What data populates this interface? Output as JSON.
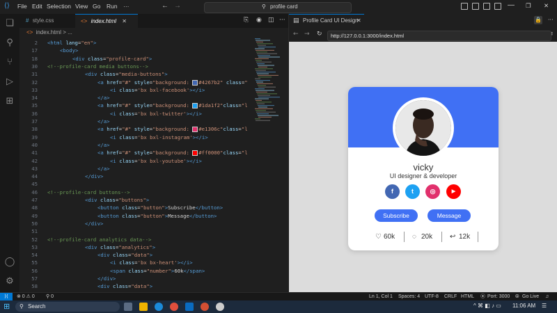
{
  "titlebar": {
    "menus": [
      "File",
      "Edit",
      "Selection",
      "View",
      "Go",
      "Run",
      "···"
    ],
    "search_text": "profile card"
  },
  "editor": {
    "tabs": [
      {
        "label": "style.css",
        "icon": "#",
        "active": false
      },
      {
        "label": "index.html",
        "icon": "<>",
        "active": true
      }
    ],
    "close_glyph": "✕",
    "breadcrumb": "index.html > ...",
    "lines": [
      {
        "n": "2",
        "indent": 0,
        "html": "<span class='tg'>&lt;html</span> <span class='at'>lang</span>=<span class='st'>\"en\"</span><span class='tg'>&gt;</span>"
      },
      {
        "n": "17",
        "indent": 1,
        "html": "<span class='tg'>&lt;body&gt;</span>"
      },
      {
        "n": "18",
        "indent": 2,
        "html": "<span class='tg'>&lt;div</span> <span class='at'>class</span>=<span class='st'>\"profile-card\"</span><span class='tg'>&gt;</span>"
      },
      {
        "n": "30",
        "indent": 0,
        "html": "<span class='cm'>&lt;!--profile-card media buttons--&gt;</span>"
      },
      {
        "n": "31",
        "indent": 3,
        "html": "<span class='tg'>&lt;div</span> <span class='at'>class</span>=<span class='st'>\"media-buttons\"</span><span class='tg'>&gt;</span>"
      },
      {
        "n": "32",
        "indent": 4,
        "html": "<span class='tg'>&lt;a</span> <span class='at'>href</span>=<span class='st'>\"#\"</span> <span class='at'>style</span>=<span class='st'>\"background: <i class='sw' style='background:#4267b2'></i>#4267b2\"</span> <span class='at'>class</span>=<span class='st'>\"</span>"
      },
      {
        "n": "33",
        "indent": 5,
        "html": "<span class='tg'>&lt;i</span> <span class='at'>class</span>=<span class='st'>'bx bxl-facebook'</span><span class='tg'>&gt;&lt;/i&gt;</span>"
      },
      {
        "n": "34",
        "indent": 4,
        "html": "<span class='tg'>&lt;/a&gt;</span>"
      },
      {
        "n": "35",
        "indent": 4,
        "html": "<span class='tg'>&lt;a</span> <span class='at'>href</span>=<span class='st'>\"#\"</span> <span class='at'>style</span>=<span class='st'>\"background: <i class='sw' style='background:#1da1f2'></i>#1da1f2\"</span><span class='at'>class</span>=<span class='st'>\"l</span>"
      },
      {
        "n": "36",
        "indent": 5,
        "html": "<span class='tg'>&lt;i</span> <span class='at'>class</span>=<span class='st'>'bx bxl-twitter'</span><span class='tg'>&gt;&lt;/i&gt;</span>"
      },
      {
        "n": "37",
        "indent": 4,
        "html": "<span class='tg'>&lt;/a&gt;</span>"
      },
      {
        "n": "38",
        "indent": 4,
        "html": "<span class='tg'>&lt;a</span> <span class='at'>href</span>=<span class='st'>\"#\"</span> <span class='at'>style</span>=<span class='st'>\"background: <i class='sw' style='background:#e1306c'></i>#e1306c\"</span><span class='at'>class</span>=<span class='st'>\"l</span>"
      },
      {
        "n": "39",
        "indent": 5,
        "html": "<span class='tg'>&lt;i</span> <span class='at'>class</span>=<span class='st'>'bx bxl-instagram'</span><span class='tg'>&gt;&lt;/i&gt;</span>"
      },
      {
        "n": "40",
        "indent": 4,
        "html": "<span class='tg'>&lt;/a&gt;</span>"
      },
      {
        "n": "41",
        "indent": 4,
        "html": "<span class='tg'>&lt;a</span> <span class='at'>href</span>=<span class='st'>\"#\"</span> <span class='at'>style</span>=<span class='st'>\"background: <i class='sw' style='background:#ff0000'></i>#ff0000\"</span><span class='at'>class</span>=<span class='st'>\"l</span>"
      },
      {
        "n": "42",
        "indent": 5,
        "html": "<span class='tg'>&lt;i</span> <span class='at'>class</span>=<span class='st'>'bx bxl-youtube'</span><span class='tg'>&gt;&lt;/i&gt;</span>"
      },
      {
        "n": "43",
        "indent": 4,
        "html": "<span class='tg'>&lt;/a&gt;</span>"
      },
      {
        "n": "44",
        "indent": 3,
        "html": "<span class='tg'>&lt;/div&gt;</span>"
      },
      {
        "n": "45",
        "indent": 0,
        "html": ""
      },
      {
        "n": "46",
        "indent": 0,
        "html": "<span class='cm'>&lt;!--profile-card buttons--&gt;</span>"
      },
      {
        "n": "47",
        "indent": 3,
        "html": "<span class='tg'>&lt;div</span> <span class='at'>class</span>=<span class='st'>\"buttons\"</span><span class='tg'>&gt;</span>"
      },
      {
        "n": "48",
        "indent": 4,
        "html": "<span class='tg'>&lt;button</span> <span class='at'>class</span>=<span class='st'>\"button\"</span><span class='tg'>&gt;</span>Subscribe<span class='tg'>&lt;/button&gt;</span>"
      },
      {
        "n": "49",
        "indent": 4,
        "html": "<span class='tg'>&lt;button</span> <span class='at'>class</span>=<span class='st'>\"button\"</span><span class='tg'>&gt;</span>Message<span class='tg'>&lt;/button&gt;</span>"
      },
      {
        "n": "50",
        "indent": 3,
        "html": "<span class='tg'>&lt;/div&gt;</span>"
      },
      {
        "n": "51",
        "indent": 0,
        "html": ""
      },
      {
        "n": "52",
        "indent": 0,
        "html": "<span class='cm'>&lt;!--profile-card analytics data--&gt;</span>"
      },
      {
        "n": "53",
        "indent": 3,
        "html": "<span class='tg'>&lt;div</span> <span class='at'>class</span>=<span class='st'>\"analytics\"</span><span class='tg'>&gt;</span>"
      },
      {
        "n": "54",
        "indent": 4,
        "html": "<span class='tg'>&lt;div</span> <span class='at'>class</span>=<span class='st'>\"data\"</span><span class='tg'>&gt;</span>"
      },
      {
        "n": "55",
        "indent": 5,
        "html": "<span class='tg'>&lt;i</span> <span class='at'>class</span>=<span class='st'>'bx bx-heart'</span><span class='tg'>&gt;&lt;/i&gt;</span>"
      },
      {
        "n": "56",
        "indent": 5,
        "html": "<span class='tg'>&lt;span</span> <span class='at'>class</span>=<span class='st'>\"number\"</span><span class='tg'>&gt;</span>60k<span class='tg'>&lt;/span&gt;</span>"
      },
      {
        "n": "57",
        "indent": 4,
        "html": "<span class='tg'>&lt;/div&gt;</span>"
      },
      {
        "n": "58",
        "indent": 4,
        "html": "<span class='tg'>&lt;div</span> <span class='at'>class</span>=<span class='st'>\"data\"</span><span class='tg'>&gt;</span>"
      },
      {
        "n": "59",
        "indent": 5,
        "html": "<span class='tg'>&lt;i</span> <span class='at'>class</span>=<span class='st'>'bx bx-message-rounded'</span><span class='tg'>&gt;&lt;/i&gt;</span>"
      }
    ]
  },
  "browser": {
    "tab_title": "Profile Card UI Design",
    "url": "http://127.0.0.1:3000/index.html"
  },
  "card": {
    "name": "vicky",
    "role": "UI designer & developer",
    "media": [
      {
        "name": "facebook",
        "glyph": "f",
        "color": "#4267b2"
      },
      {
        "name": "twitter",
        "glyph": "t",
        "color": "#1da1f2"
      },
      {
        "name": "instagram",
        "glyph": "◎",
        "color": "#e1306c"
      },
      {
        "name": "youtube",
        "glyph": "▶",
        "color": "#ff0000"
      }
    ],
    "buttons": [
      "Subscribe",
      "Message"
    ],
    "analytics": [
      {
        "icon": "heart-icon",
        "glyph": "♡",
        "value": "60k"
      },
      {
        "icon": "comment-icon",
        "glyph": "◌",
        "value": "20k"
      },
      {
        "icon": "share-icon",
        "glyph": "↩",
        "value": "12k"
      }
    ],
    "accent": "#4070f4"
  },
  "statusbar": {
    "problems": "⊗ 0 ⚠ 0",
    "ports": "⚲ 0",
    "position": "Ln 1, Col 1",
    "spaces": "Spaces: 4",
    "encoding": "UTF-8",
    "eol": "CRLF",
    "language": "HTML",
    "port": "Port: 3000",
    "golive": "Go Live"
  },
  "taskbar": {
    "search": "Search",
    "time": "11:06 AM"
  }
}
